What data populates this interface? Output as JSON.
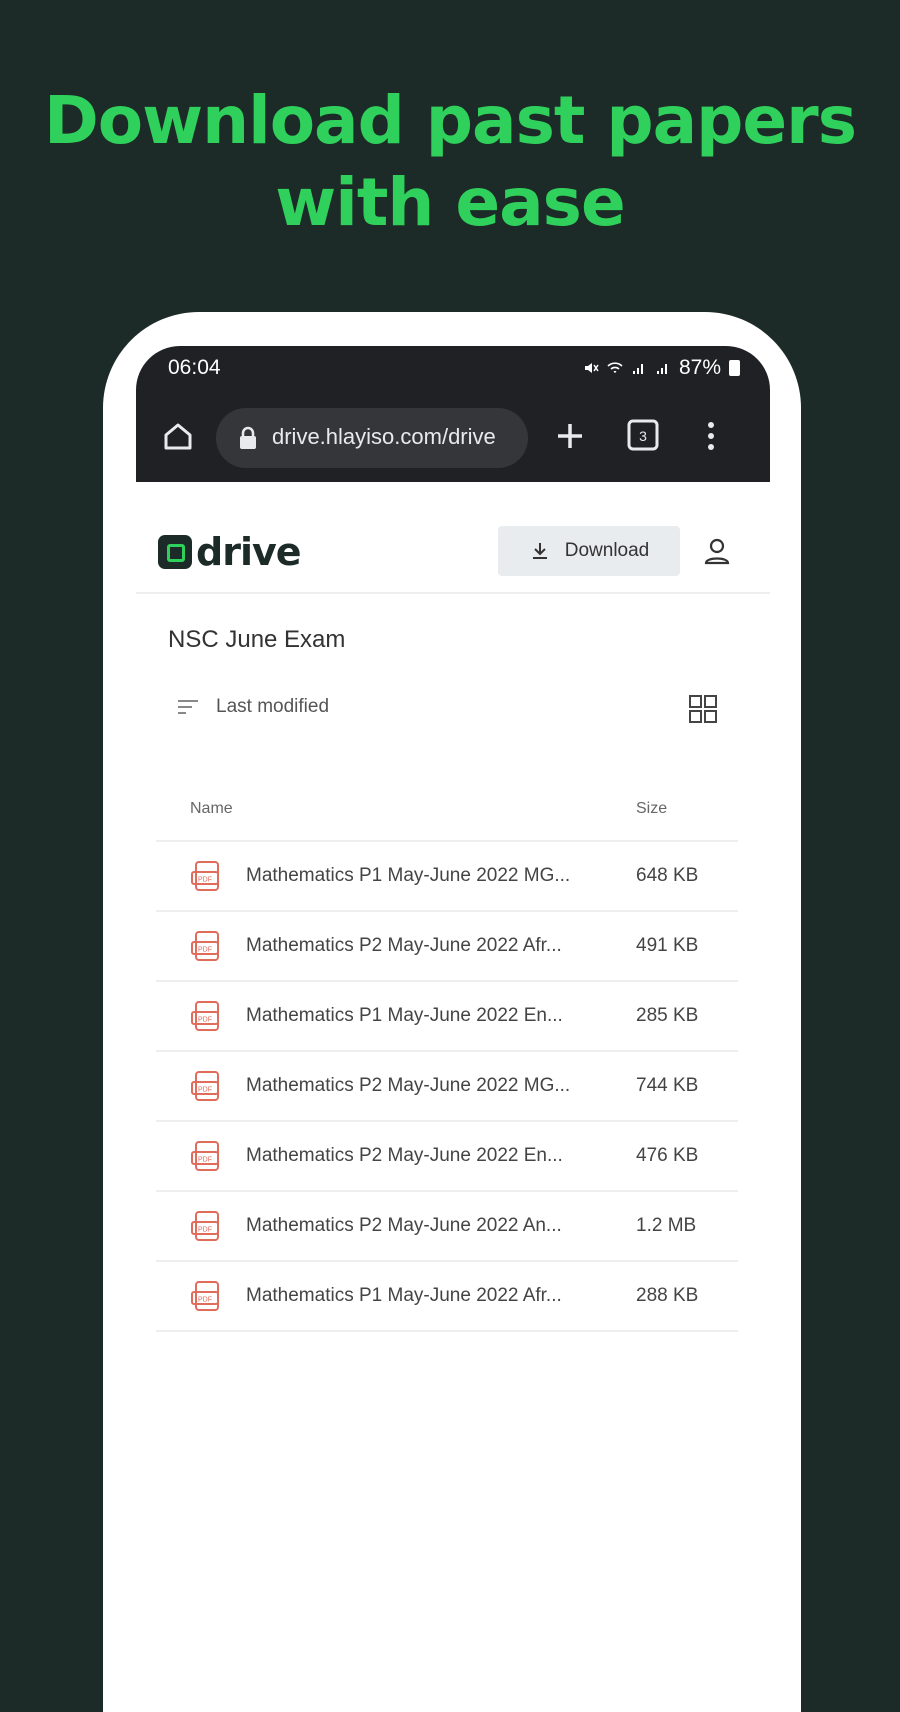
{
  "headline": {
    "line1": "Download past papers",
    "line2": "with ease"
  },
  "status_bar": {
    "time": "06:04",
    "battery": "87%"
  },
  "browser": {
    "url": "drive.hlayiso.com/drive"
  },
  "app": {
    "logo_text": "drive",
    "download_label": "Download",
    "breadcrumb": "NSC June Exam",
    "sort_label": "Last modified"
  },
  "table": {
    "columns": {
      "name": "Name",
      "size": "Size"
    },
    "rows": [
      {
        "name": "Mathematics P1 May-June 2022 MG...",
        "size": "648 KB"
      },
      {
        "name": "Mathematics P2 May-June 2022 Afr...",
        "size": "491 KB"
      },
      {
        "name": "Mathematics P1 May-June 2022 En...",
        "size": "285 KB"
      },
      {
        "name": "Mathematics P2 May-June 2022 MG...",
        "size": "744 KB"
      },
      {
        "name": "Mathematics P2 May-June 2022 En...",
        "size": "476 KB"
      },
      {
        "name": "Mathematics P2 May-June 2022 An...",
        "size": "1.2 MB"
      },
      {
        "name": "Mathematics P1 May-June 2022 Afr...",
        "size": "288 KB"
      }
    ]
  },
  "colors": {
    "background": "#1c2b27",
    "accent": "#2fd15c",
    "file_icon": "#e06c5c"
  }
}
